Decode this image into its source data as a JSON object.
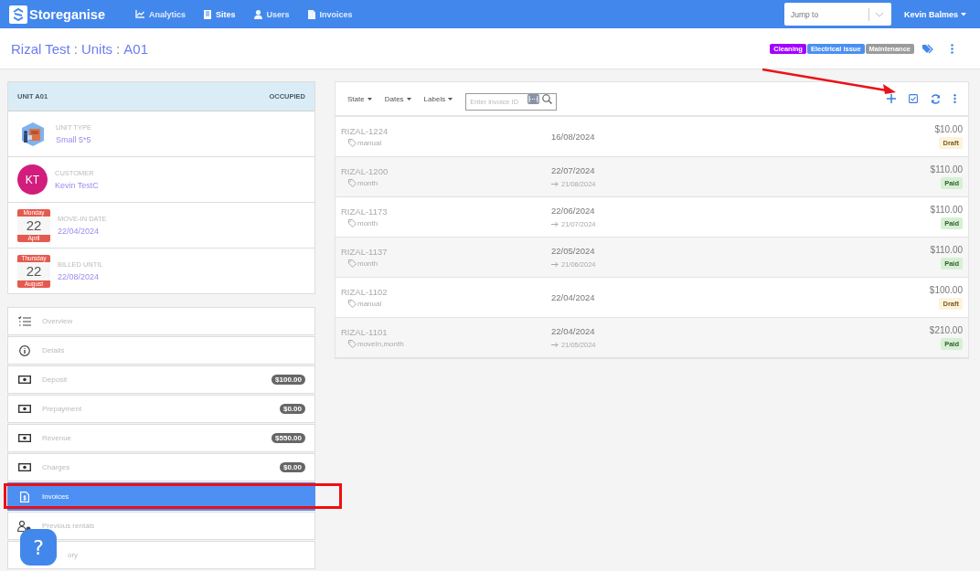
{
  "navbar": {
    "brand": "Storeganise",
    "links": [
      {
        "label": "Analytics",
        "kind": "chart",
        "selected": false
      },
      {
        "label": "Sites",
        "kind": "building",
        "selected": true
      },
      {
        "label": "Users",
        "kind": "user",
        "selected": false
      },
      {
        "label": "Invoices",
        "kind": "file",
        "selected": false
      }
    ],
    "jump": {
      "placeholder": "Jump to"
    },
    "user": "Kevin Balmes"
  },
  "header": {
    "crumbs": [
      "Rizal Test",
      "Units",
      "A01"
    ],
    "separator": ":",
    "tags": [
      {
        "label": "Cleaning",
        "color": "#a100ff"
      },
      {
        "label": "Electrical issue",
        "color": "#4a90f0"
      },
      {
        "label": "Maintenance",
        "color": "#9b9b9b"
      }
    ]
  },
  "unit": {
    "title": "UNIT A01",
    "state": "OCCUPIED",
    "fields": [
      {
        "kind": "unittype",
        "label": "UNIT TYPE",
        "value": "Small 5*5"
      },
      {
        "kind": "avatar",
        "label": "CUSTOMER",
        "value": "Kevin TestC",
        "initials": "KT"
      },
      {
        "kind": "calendar",
        "label": "MOVE-IN DATE",
        "value": "22/04/2024",
        "day": "22",
        "weekday": "Monday",
        "month": "April"
      },
      {
        "kind": "calendar",
        "label": "BILLED UNTIL",
        "value": "22/08/2024",
        "day": "22",
        "weekday": "Thursday",
        "month": "August"
      }
    ]
  },
  "menu": [
    {
      "label": "Overview",
      "kind": "list",
      "selected": false
    },
    {
      "label": "Details",
      "kind": "info",
      "selected": false
    },
    {
      "label": "Deposit",
      "kind": "money",
      "badge": "$100.00",
      "selected": false
    },
    {
      "label": "Prepayment",
      "kind": "money",
      "badge": "$0.00",
      "selected": false
    },
    {
      "label": "Revenue",
      "kind": "money",
      "badge": "$550.00",
      "selected": false
    },
    {
      "label": "Charges",
      "kind": "money",
      "badge": "$0.00",
      "selected": false
    },
    {
      "label": "Invoices",
      "kind": "invoice",
      "selected": true
    },
    {
      "label": "Previous rentals",
      "kind": "users",
      "selected": false
    },
    {
      "label": "ory",
      "kind": "covered",
      "selected": false
    }
  ],
  "help": "?",
  "invoices": {
    "filters": [
      "State",
      "Dates",
      "Labels"
    ],
    "search": {
      "placeholder": "Enter invoice ID"
    },
    "rows": [
      {
        "id": "RIZAL-1224",
        "labels": "manual",
        "date": "16/08/2024",
        "amount": "$10.00",
        "status": "Draft",
        "kind": "draft"
      },
      {
        "id": "RIZAL-1200",
        "labels": "month",
        "date": "22/07/2024",
        "end": "21/08/2024",
        "amount": "$110.00",
        "status": "Paid",
        "kind": "paid"
      },
      {
        "id": "RIZAL-1173",
        "labels": "month",
        "date": "22/06/2024",
        "end": "21/07/2024",
        "amount": "$110.00",
        "status": "Paid",
        "kind": "paid"
      },
      {
        "id": "RIZAL-1137",
        "labels": "month",
        "date": "22/05/2024",
        "end": "21/06/2024",
        "amount": "$110.00",
        "status": "Paid",
        "kind": "paid"
      },
      {
        "id": "RIZAL-1102",
        "labels": "manual",
        "date": "22/04/2024",
        "amount": "$100.00",
        "status": "Draft",
        "kind": "draft"
      },
      {
        "id": "RIZAL-1101",
        "labels": "moveIn,month",
        "date": "22/04/2024",
        "end": "21/05/2024",
        "amount": "$210.00",
        "status": "Paid",
        "kind": "paid"
      }
    ]
  }
}
